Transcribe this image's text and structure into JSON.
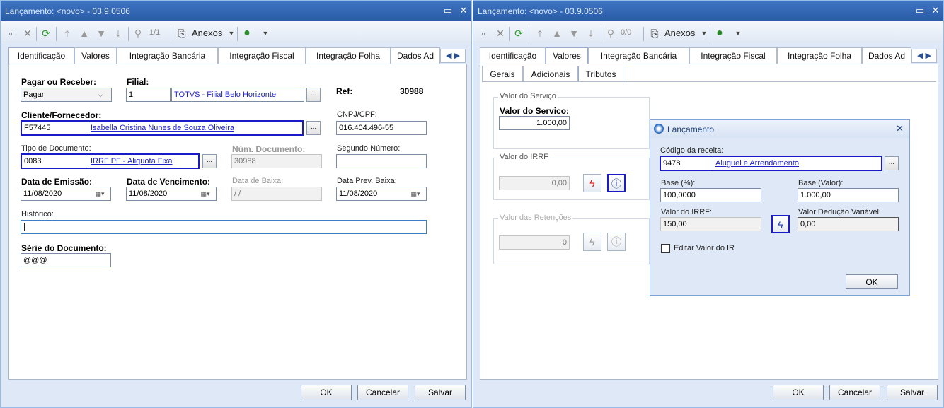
{
  "left": {
    "title": "Lançamento: <novo> - 03.9.0506",
    "record_counter": "1/1",
    "attachments_label": "Anexos",
    "tabs": [
      "Identificação",
      "Valores",
      "Integração Bancária",
      "Integração Fiscal",
      "Integração Folha",
      "Dados Ad"
    ],
    "form": {
      "pagar_receber_label": "Pagar ou Receber:",
      "pagar_receber_value": "Pagar",
      "filial_label": "Filial:",
      "filial_code": "1",
      "filial_name": "TOTVS - Filial Belo Horizonte",
      "ref_label": "Ref:",
      "ref_value": "30988",
      "cliente_label": "Cliente/Fornecedor:",
      "cliente_code": "F57445",
      "cliente_name": "Isabella Cristina Nunes de Souza Oliveira",
      "cnpj_label": "CNPJ/CPF:",
      "cnpj_value": "016.404.496-55",
      "tipo_doc_label": "Tipo de Documento:",
      "tipo_doc_code": "0083",
      "tipo_doc_name": "IRRF PF - Aliquota Fixa",
      "num_doc_label": "Núm. Documento:",
      "num_doc_value": "30988",
      "segundo_numero_label": "Segundo Número:",
      "segundo_numero_value": "",
      "data_emissao_label": "Data de Emissão:",
      "data_emissao_value": "11/08/2020",
      "data_venc_label": "Data de Vencimento:",
      "data_venc_value": "11/08/2020",
      "data_baixa_label": "Data de Baixa:",
      "data_baixa_value": " /  /",
      "data_prev_label": "Data Prev. Baixa:",
      "data_prev_value": "11/08/2020",
      "historico_label": "Histórico:",
      "historico_value": "",
      "serie_label": "Série do Documento:",
      "serie_value": "@@@",
      "ellipsis": "..."
    },
    "buttons": {
      "ok": "OK",
      "cancel": "Cancelar",
      "save": "Salvar"
    }
  },
  "right": {
    "title": "Lançamento: <novo> - 03.9.0506",
    "record_counter": "0/0",
    "attachments_label": "Anexos",
    "tabs": [
      "Identificação",
      "Valores",
      "Integração Bancária",
      "Integração Fiscal",
      "Integração Folha",
      "Dados Ad"
    ],
    "subtabs": [
      "Gerais",
      "Adicionais",
      "Tributos"
    ],
    "valor_servico_group": "Valor do Serviço",
    "valor_servico_label": "Valor do Servico:",
    "valor_servico_value": "1.000,00",
    "valor_irrf_group": "Valor do IRRF",
    "valor_irrf_value": "0,00",
    "retencoes_group": "Valor das Retenções",
    "retencoes_value": "0",
    "buttons": {
      "ok": "OK",
      "cancel": "Cancelar",
      "save": "Salvar"
    }
  },
  "dialog": {
    "title": "Lançamento",
    "codigo_label": "Código da receita:",
    "codigo_code": "9478",
    "codigo_name": "Aluguel e Arrendamento",
    "base_pct_label": "Base (%):",
    "base_pct_value": "100,0000",
    "base_valor_label": "Base (Valor):",
    "base_valor_value": "1.000,00",
    "valor_irrf_label": "Valor do IRRF:",
    "valor_irrf_value": "150,00",
    "deducao_label": "Valor Dedução Variável:",
    "deducao_value": "0,00",
    "editar_label": "Editar Valor do IR",
    "ok": "OK",
    "ellipsis": "..."
  },
  "colors": {
    "highlight": "#1a1ac8",
    "link": "#1e22c6",
    "titlebar": "#2a5ca8"
  }
}
